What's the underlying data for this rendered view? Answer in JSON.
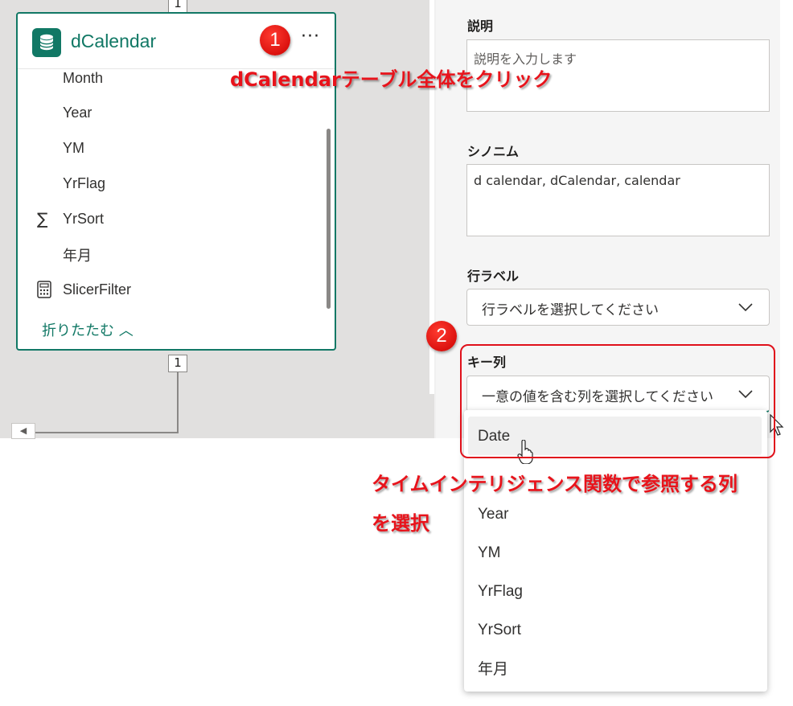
{
  "colors": {
    "accent": "#117865",
    "annotation": "#e8131b",
    "canvas": "#e1e0df"
  },
  "canvas": {
    "cardinality_top": "1",
    "cardinality_bottom": "1",
    "table_card": {
      "icon": "database-icon",
      "name": "dCalendar",
      "more_label": "···",
      "fields": [
        {
          "label": "Month",
          "icon": ""
        },
        {
          "label": "Year",
          "icon": ""
        },
        {
          "label": "YM",
          "icon": ""
        },
        {
          "label": "YrFlag",
          "icon": ""
        },
        {
          "label": "YrSort",
          "icon": "sum-icon",
          "icon_glyph": "∑"
        },
        {
          "label": "年月",
          "icon": ""
        },
        {
          "label": "SlicerFilter",
          "icon": "calculator-icon"
        }
      ],
      "collapse_label": "折りたたむ ︿"
    }
  },
  "properties": {
    "description": {
      "label": "説明",
      "placeholder": "説明を入力します"
    },
    "synonyms": {
      "label": "シノニム",
      "value": "d calendar, dCalendar, calendar"
    },
    "row_label": {
      "label": "行ラベル",
      "selected": "行ラベルを選択してください"
    },
    "key_column": {
      "label": "キー列",
      "selected": "一意の値を含む列を選択してください",
      "options": [
        "Date",
        "Year",
        "YM",
        "YrFlag",
        "YrSort",
        "年月"
      ]
    }
  },
  "annotations": {
    "badge1": "1",
    "badge2": "2",
    "note1": "dCalendarテーブル全体をクリック",
    "note2_line1": "タイムインテリジェンス関数で参照する列",
    "note2_line2": "を選択"
  }
}
